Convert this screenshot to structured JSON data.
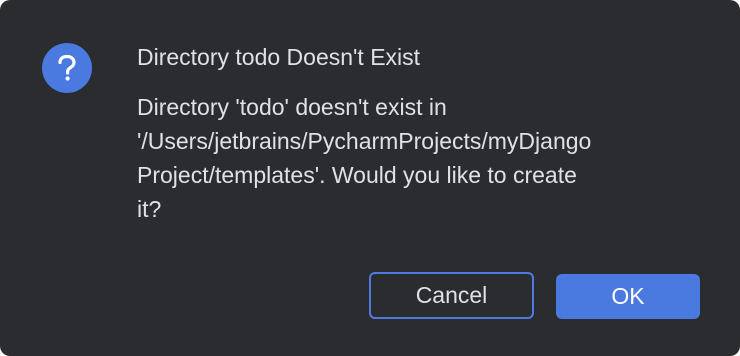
{
  "dialog": {
    "icon": "question-icon",
    "title": "Directory todo Doesn't Exist",
    "message_lines": [
      "Directory 'todo' doesn't exist in",
      "'/Users/jetbrains/PycharmProjects/myDjango",
      "Project/templates'. Would you like to create",
      "it?"
    ],
    "buttons": {
      "cancel_label": "Cancel",
      "ok_label": "OK"
    },
    "colors": {
      "background": "#2b2c30",
      "accent": "#4a79e0",
      "text": "#dfe1e5"
    }
  }
}
